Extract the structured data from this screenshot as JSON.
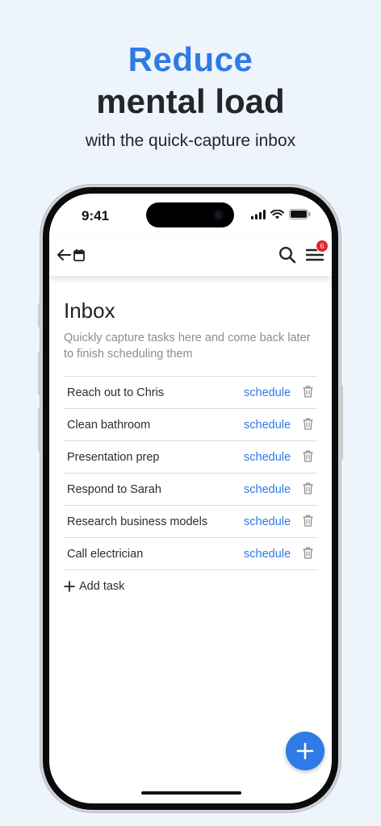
{
  "promo": {
    "line1": "Reduce",
    "line2": "mental load",
    "line3": "with the quick-capture inbox"
  },
  "status_bar": {
    "time": "9:41"
  },
  "appbar": {
    "back_icon": "arrow-left-icon",
    "calendar_icon": "calendar-icon",
    "search_icon": "search-icon",
    "menu_icon": "menu-icon",
    "menu_badge": "6"
  },
  "inbox": {
    "title": "Inbox",
    "subtitle": "Quickly capture tasks here and come back later to finish scheduling them",
    "tasks": [
      {
        "name": "Reach out to Chris",
        "action": "schedule"
      },
      {
        "name": "Clean bathroom",
        "action": "schedule"
      },
      {
        "name": "Presentation prep",
        "action": "schedule"
      },
      {
        "name": "Respond to Sarah",
        "action": "schedule"
      },
      {
        "name": "Research business models",
        "action": "schedule"
      },
      {
        "name": "Call electrician",
        "action": "schedule"
      }
    ],
    "add_task_label": "Add task"
  },
  "colors": {
    "accent": "#2f7ae5",
    "badge": "#e3262b",
    "background": "#eef4fb"
  }
}
